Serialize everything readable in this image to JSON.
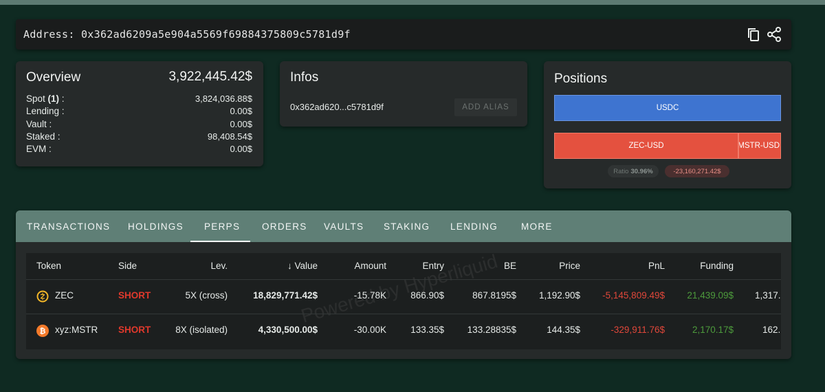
{
  "address_bar": {
    "text": "Address: 0x362ad6209a5e904a5569f69884375809c5781d9f",
    "copy_icon": "copy-icon",
    "share_icon": "share-icon"
  },
  "overview": {
    "title": "Overview",
    "total": "3,922,445.42$",
    "rows": [
      {
        "label_pre": "Spot ",
        "label_bold": "(1)",
        "label_post": " :",
        "value": "3,824,036.88$"
      },
      {
        "label": "Lending :",
        "value": "0.00$"
      },
      {
        "label": "Vault :",
        "value": "0.00$"
      },
      {
        "label": "Staked :",
        "value": "98,408.54$"
      },
      {
        "label": "EVM :",
        "value": "0.00$"
      }
    ]
  },
  "infos": {
    "title": "Infos",
    "address_short": "0x362ad620...c5781d9f",
    "alias_button": "ADD ALIAS"
  },
  "positions": {
    "title": "Positions",
    "usdc_label": "USDC",
    "zec_label": "ZEC-USD",
    "mstr_label": "xyz:MSTR-USD",
    "ratio_label": "Ratio",
    "ratio_value": "30.96%",
    "pnl_value": "-23,160,271.42$",
    "colors": {
      "long": "#3e74d0",
      "short": "#e4513f"
    }
  },
  "tabs": {
    "items": [
      "TRANSACTIONS",
      "HOLDINGS",
      "PERPS",
      "ORDERS",
      "VAULTS",
      "STAKING",
      "LENDING",
      "MORE"
    ],
    "active": "PERPS"
  },
  "table": {
    "headers": {
      "token": "Token",
      "side": "Side",
      "lev": "Lev.",
      "value_arrow": "↓",
      "value": "Value",
      "amount": "Amount",
      "entry": "Entry",
      "be": "BE",
      "price": "Price",
      "pnl": "PnL",
      "funding": "Funding"
    },
    "rows": [
      {
        "icon": "zcash-icon",
        "token": "ZEC",
        "side": "SHORT",
        "lev": "5X (cross)",
        "value": "18,829,771.42$",
        "amount": "-15.78K",
        "entry": "866.90$",
        "be": "867.8195$",
        "price": "1,192.90$",
        "pnl": "-5,145,809.49$",
        "funding": "21,439.09$",
        "extra": "1,317."
      },
      {
        "icon": "bitcoin-icon",
        "token": "xyz:MSTR",
        "side": "SHORT",
        "lev": "8X (isolated)",
        "value": "4,330,500.00$",
        "amount": "-30.00K",
        "entry": "133.35$",
        "be": "133.28835$",
        "price": "144.35$",
        "pnl": "-329,911.76$",
        "funding": "2,170.17$",
        "extra": "162."
      }
    ],
    "watermark": "Powered by Hyperliquid"
  }
}
